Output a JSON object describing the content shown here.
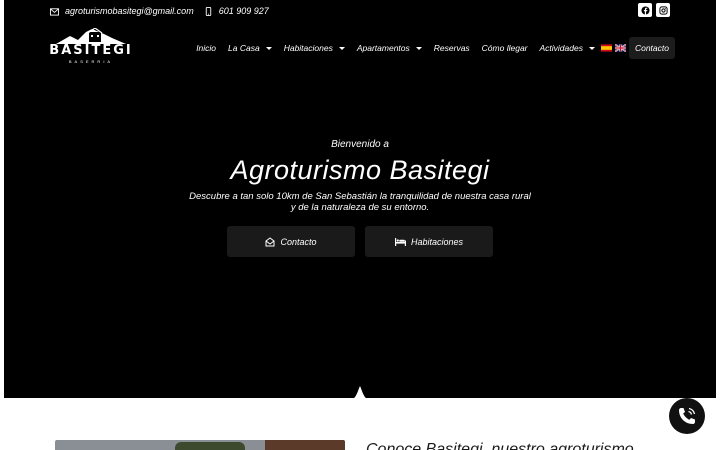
{
  "topbar": {
    "email": "agroturismobasitegi@gmail.com",
    "phone": "601 909 927"
  },
  "logo": {
    "name": "BASITEGI",
    "subtitle": "BASERRIA"
  },
  "nav": {
    "items": [
      {
        "label": "Inicio",
        "dropdown": false
      },
      {
        "label": "La Casa",
        "dropdown": true
      },
      {
        "label": "Habitaciones",
        "dropdown": true
      },
      {
        "label": "Apartamentos",
        "dropdown": true
      },
      {
        "label": "Reservas",
        "dropdown": false
      },
      {
        "label": "Cómo llegar",
        "dropdown": false
      },
      {
        "label": "Actividades",
        "dropdown": true
      }
    ],
    "cta": "Contacto",
    "languages": [
      "es",
      "en"
    ]
  },
  "hero": {
    "welcome": "Bienvenido a",
    "title": "Agroturismo Basitegi",
    "description_line1": "Descubre a tan solo 10km de San Sebastián la tranquilidad de nuestra casa rural",
    "description_line2": "y de la naturaleza de su entorno.",
    "buttons": {
      "contacto": "Contacto",
      "habitaciones": "Habitaciones"
    }
  },
  "section": {
    "title": "Conoce Basitegi, nuestro agroturismo"
  },
  "icons": {
    "email": "envelope-icon",
    "phone": "mobile-phone-icon",
    "facebook": "facebook-icon",
    "instagram": "instagram-icon",
    "contact_button": "envelope-open-icon",
    "rooms_button": "bed-icon",
    "fab": "phone-call-icon"
  },
  "colors": {
    "hero_bg": "#000000",
    "button_bg": "#1a1a1a",
    "text": "#ffffff"
  }
}
